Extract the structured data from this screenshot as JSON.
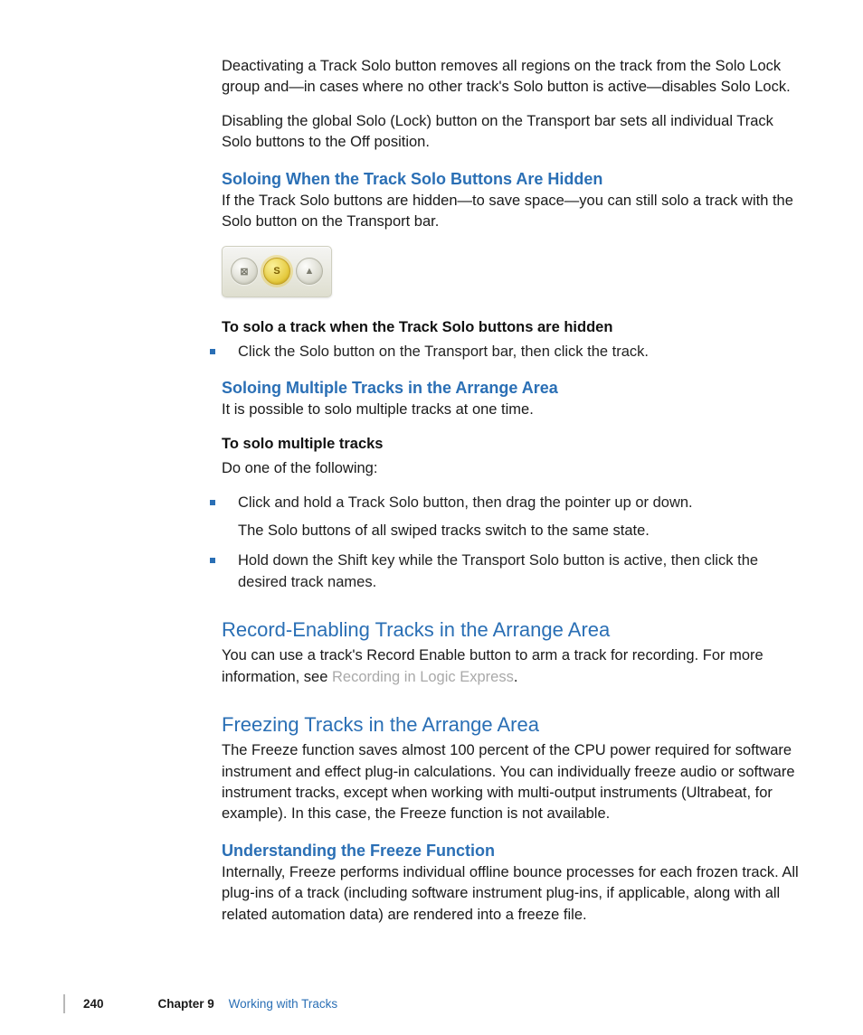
{
  "intro": {
    "p1": "Deactivating a Track Solo button removes all regions on the track from the Solo Lock group and—in cases where no other track's Solo button is active—disables Solo Lock.",
    "p2": "Disabling the global Solo (Lock) button on the Transport bar sets all individual Track Solo buttons to the Off position."
  },
  "section1": {
    "heading": "Soloing When the Track Solo Buttons Are Hidden",
    "p1": "If the Track Solo buttons are hidden—to save space—you can still solo a track with the Solo button on the Transport bar.",
    "buttons": {
      "left_glyph": "⊠",
      "mid_glyph": "S",
      "right_glyph": "▲"
    },
    "sub1": "To solo a track when the Track Solo buttons are hidden",
    "bullet1": "Click the Solo button on the Transport bar, then click the track."
  },
  "section2": {
    "heading": "Soloing Multiple Tracks in the Arrange Area",
    "p1": "It is possible to solo multiple tracks at one time.",
    "sub1": "To solo multiple tracks",
    "sub1_line": "Do one of the following:",
    "bullet1": "Click and hold a Track Solo button, then drag the pointer up or down.",
    "bullet1_after": "The Solo buttons of all swiped tracks switch to the same state.",
    "bullet2": "Hold down the Shift key while the Transport Solo button is active, then click the desired track names."
  },
  "section3": {
    "heading": "Record-Enabling Tracks in the Arrange Area",
    "p1a": "You can use a track's Record Enable button to arm a track for recording. For more information, see ",
    "p1_link": "Recording in Logic Express",
    "p1b": "."
  },
  "section4": {
    "heading": "Freezing Tracks in the Arrange Area",
    "p1": "The Freeze function saves almost 100 percent of the CPU power required for software instrument and effect plug-in calculations. You can individually freeze audio or software instrument tracks, except when working with multi-output instruments (Ultrabeat, for example). In this case, the Freeze function is not available.",
    "sub_heading": "Understanding the Freeze Function",
    "p2": "Internally, Freeze performs individual offline bounce processes for each frozen track. All plug-ins of a track (including software instrument plug-ins, if applicable, along with all related automation data) are rendered into a freeze file."
  },
  "footer": {
    "page": "240",
    "chapter_label": "Chapter 9",
    "chapter_title": "Working with Tracks"
  }
}
